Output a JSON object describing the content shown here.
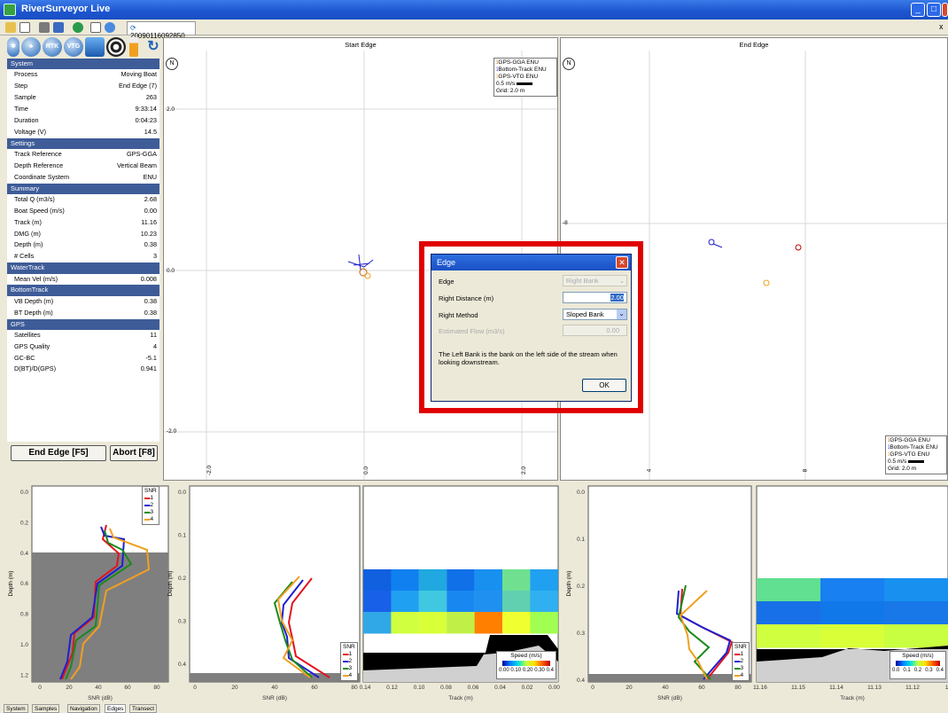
{
  "window": {
    "title": "RiverSurveyor Live"
  },
  "file_tab": {
    "label": "20090116092850"
  },
  "toolbar_icons": [
    "bluetooth-icon",
    "footprint-icon",
    "rtk-icon",
    "vtg-icon",
    "water-icon",
    "film-reel-icon",
    "battery-icon",
    "refresh-icon"
  ],
  "toolbar_labels": {
    "rtk": "RTK",
    "vtg": "VTG"
  },
  "info": {
    "system": {
      "title": "System",
      "rows": [
        [
          "Process",
          "Moving Boat"
        ],
        [
          "Step",
          "End Edge (7)"
        ],
        [
          "Sample",
          "263"
        ],
        [
          "Time",
          "9:33:14"
        ],
        [
          "Duration",
          "0:04:23"
        ],
        [
          "Voltage (V)",
          "14.5"
        ]
      ]
    },
    "settings": {
      "title": "Settings",
      "rows": [
        [
          "Track Reference",
          "GPS-GGA"
        ],
        [
          "Depth Reference",
          "Vertical Beam"
        ],
        [
          "Coordinate System",
          "ENU"
        ]
      ]
    },
    "summary": {
      "title": "Summary",
      "rows": [
        [
          "Total Q (m3/s)",
          "2.68"
        ],
        [
          "Boat Speed (m/s)",
          "0.00"
        ],
        [
          "Track (m)",
          "11.16"
        ],
        [
          "DMG (m)",
          "10.23"
        ],
        [
          "Depth (m)",
          "0.38"
        ],
        [
          "# Cells",
          "3"
        ]
      ]
    },
    "watertrack": {
      "title": "WaterTrack",
      "rows": [
        [
          "Mean Vel (m/s)",
          "0.008"
        ]
      ]
    },
    "bottomtrack": {
      "title": "BottomTrack",
      "rows": [
        [
          "VB Depth (m)",
          "0.38"
        ],
        [
          "BT Depth (m)",
          "0.38"
        ]
      ]
    },
    "gps": {
      "title": "GPS",
      "rows": [
        [
          "Satellites",
          "11"
        ],
        [
          "GPS Quality",
          "4"
        ],
        [
          "GC-BC",
          "-5.1"
        ],
        [
          "D(BT)/D(GPS)",
          "0.941"
        ]
      ]
    }
  },
  "buttons": {
    "end_edge": "End Edge [F5]",
    "abort": "Abort [F8]"
  },
  "start_edge": {
    "title": "Start Edge",
    "y_ticks": [
      "2.0",
      "0.0",
      "-2.0"
    ],
    "x_ticks": [
      "-2.0",
      "0.0",
      "2.0"
    ]
  },
  "end_edge": {
    "title": "End Edge",
    "y_ticks": [
      "-8"
    ],
    "x_ticks": [
      "4",
      "8"
    ]
  },
  "track_legend": {
    "items": [
      "GPS-GGA ENU",
      "Bottom-Track ENU",
      "GPS-VTG ENU"
    ],
    "scale": "0.5 m/s",
    "grid": "Grid: 2.0 m"
  },
  "dialog": {
    "title": "Edge",
    "edge_label": "Edge",
    "edge_value": "Right Bank",
    "dist_label": "Right Distance (m)",
    "dist_value": "2.00",
    "method_label": "Right Method",
    "method_value": "Sloped Bank",
    "flow_label": "Estimated Flow (m3/s)",
    "flow_value": "0.00",
    "note": "The Left Bank is the bank on the left side of the stream when looking downstream.",
    "ok": "OK"
  },
  "snr_legend": {
    "title": "SNR",
    "items": [
      "1",
      "2",
      "3",
      "4"
    ],
    "colors": [
      "#e0141e",
      "#1f1fd0",
      "#1a8a1a",
      "#f0a020"
    ]
  },
  "profiles": {
    "ylabel": "Depth (m)",
    "xlabel": "SNR (dB)",
    "x_ticks": [
      "0",
      "20",
      "40",
      "60",
      "80"
    ],
    "p1_y": [
      "0.0",
      "0.2",
      "0.4",
      "0.6",
      "0.8",
      "1.0",
      "1.2"
    ],
    "p2_y": [
      "0.0",
      "0.1",
      "0.2",
      "0.3",
      "0.4"
    ],
    "p3_y": [
      "0.0",
      "0.1",
      "0.2",
      "0.3",
      "0.4"
    ]
  },
  "contour": {
    "xlabel": "Track (m)",
    "speed_title": "Speed (m/s)",
    "c1_x": [
      "0.14",
      "0.12",
      "0.10",
      "0.08",
      "0.06",
      "0.04",
      "0.02",
      "0.00"
    ],
    "c1_scale": [
      "0.00",
      "0.10",
      "0.20",
      "0.30",
      "0.4"
    ],
    "c2_x": [
      "11.16",
      "11.15",
      "11.14",
      "11.13",
      "11.12",
      "11.1"
    ],
    "c2_scale": [
      "0.0",
      "0.1",
      "0.2",
      "0.3",
      "0.4"
    ]
  },
  "bottom_tabs": [
    "System",
    "Samples",
    "Navigation",
    "Edges",
    "Transect"
  ]
}
